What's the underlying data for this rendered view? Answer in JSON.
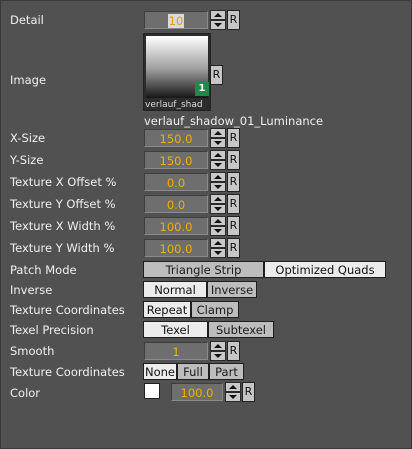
{
  "properties": {
    "detail": {
      "label": "Detail",
      "value": "10"
    },
    "image": {
      "label": "Image",
      "thumb_caption": "verlauf_shad",
      "name": "verlauf_shadow_01_Luminance",
      "badge": "1"
    },
    "x_size": {
      "label": "X-Size",
      "value": "150.0"
    },
    "y_size": {
      "label": "Y-Size",
      "value": "150.0"
    },
    "tex_x_offset": {
      "label": "Texture X Offset %",
      "value": "0.0"
    },
    "tex_y_offset": {
      "label": "Texture Y Offset %",
      "value": "0.0"
    },
    "tex_x_width": {
      "label": "Texture X Width %",
      "value": "100.0"
    },
    "tex_y_width": {
      "label": "Texture Y Width %",
      "value": "100.0"
    },
    "patch_mode": {
      "label": "Patch Mode",
      "options": [
        "Triangle Strip",
        "Optimized Quads"
      ],
      "selected": "Optimized Quads"
    },
    "inverse": {
      "label": "Inverse",
      "options": [
        "Normal",
        "Inverse"
      ],
      "selected": "Normal"
    },
    "tex_coords_mode": {
      "label": "Texture Coordinates",
      "options": [
        "Repeat",
        "Clamp"
      ],
      "selected": "Repeat"
    },
    "texel_precision": {
      "label": "Texel Precision",
      "options": [
        "Texel",
        "Subtexel"
      ],
      "selected": "Texel"
    },
    "smooth": {
      "label": "Smooth",
      "value": "1"
    },
    "tex_coords_range": {
      "label": "Texture Coordinates",
      "options": [
        "None",
        "Full",
        "Part"
      ],
      "selected": "None"
    },
    "color": {
      "label": "Color",
      "value": "100.0",
      "swatch": "#ffffff"
    }
  },
  "reset_label": "R",
  "colors": {
    "value_text": "#f0b000",
    "panel": "#515151",
    "button": "#bdbdbd",
    "button_active": "#ececec"
  }
}
